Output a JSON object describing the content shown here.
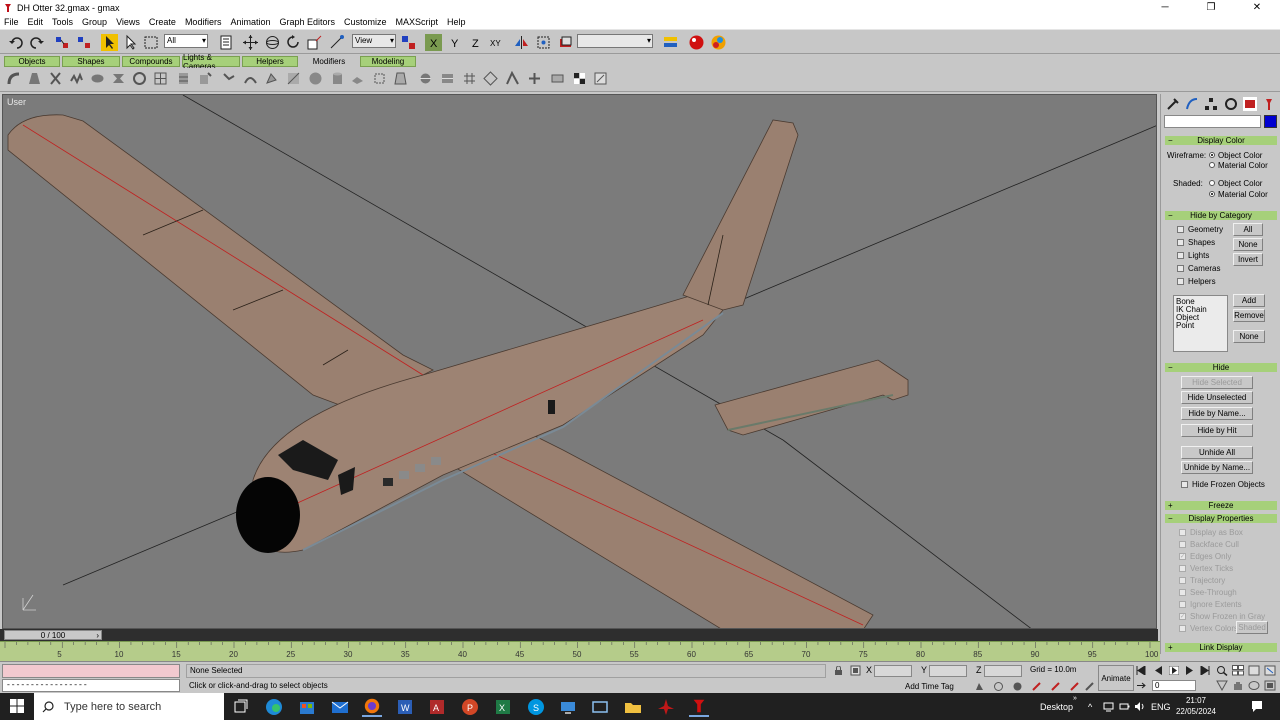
{
  "window": {
    "title": "DH Otter 32.gmax - gmax",
    "minimize": "─",
    "maximize": "❐",
    "close": "✕"
  },
  "menu": [
    "File",
    "Edit",
    "Tools",
    "Group",
    "Views",
    "Create",
    "Modifiers",
    "Animation",
    "Graph Editors",
    "Customize",
    "MAXScript",
    "Help"
  ],
  "toolbar": {
    "selection_filter": "All",
    "reference_coord": "View",
    "named_selection": ""
  },
  "tabs": [
    "Objects",
    "Shapes",
    "Compounds",
    "Lights & Cameras",
    "Helpers",
    "Modifiers",
    "Modeling"
  ],
  "active_tab": "Modifiers",
  "viewport": {
    "label": "User",
    "aircraft_color": "#9a8070",
    "background": "#7b7b7b"
  },
  "command_panel": {
    "display_color": {
      "header": "Display Color",
      "wireframe_label": "Wireframe:",
      "shaded_label": "Shaded:",
      "object_color": "Object Color",
      "material_color": "Material Color"
    },
    "hide_by_category": {
      "header": "Hide by Category",
      "items": [
        "Geometry",
        "Shapes",
        "Lights",
        "Cameras",
        "Helpers"
      ],
      "buttons": [
        "All",
        "None",
        "Invert"
      ],
      "list": [
        "Bone",
        "IK Chain Object",
        "Point"
      ],
      "list_buttons": [
        "Add",
        "Remove",
        "None"
      ]
    },
    "hide": {
      "header": "Hide",
      "buttons": [
        "Hide Selected",
        "Hide Unselected",
        "Hide by Name...",
        "Hide by Hit",
        "Unhide All",
        "Unhide by Name..."
      ],
      "hide_frozen": "Hide Frozen Objects"
    },
    "freeze_header": "Freeze",
    "display_properties": {
      "header": "Display Properties",
      "items": [
        "Display as Box",
        "Backface Cull",
        "Edges Only",
        "Vertex Ticks",
        "Trajectory",
        "See-Through",
        "Ignore Extents",
        "Show Frozen in Gray",
        "Vertex Colors"
      ],
      "shaded_button": "Shaded"
    },
    "link_display_header": "Link Display"
  },
  "timeline": {
    "frame_display": "0 / 100",
    "ticks": [
      "5",
      "10",
      "15",
      "20",
      "25",
      "30",
      "35",
      "40",
      "45",
      "50",
      "55",
      "60",
      "65",
      "70",
      "75",
      "80",
      "85",
      "90",
      "95",
      "100"
    ]
  },
  "status": {
    "listener_input": "-----------------",
    "selection": "None Selected",
    "prompt": "Click or click-and-drag to select objects",
    "x_label": "X",
    "y_label": "Y",
    "z_label": "Z",
    "grid": "Grid = 10.0m",
    "add_time_tag": "Add Time Tag",
    "animate": "Animate",
    "current_frame": "0"
  },
  "taskbar": {
    "search_placeholder": "Type here to search",
    "desktop_label": "Desktop",
    "language": "ENG",
    "time": "21:07",
    "date": "22/05/2024"
  }
}
